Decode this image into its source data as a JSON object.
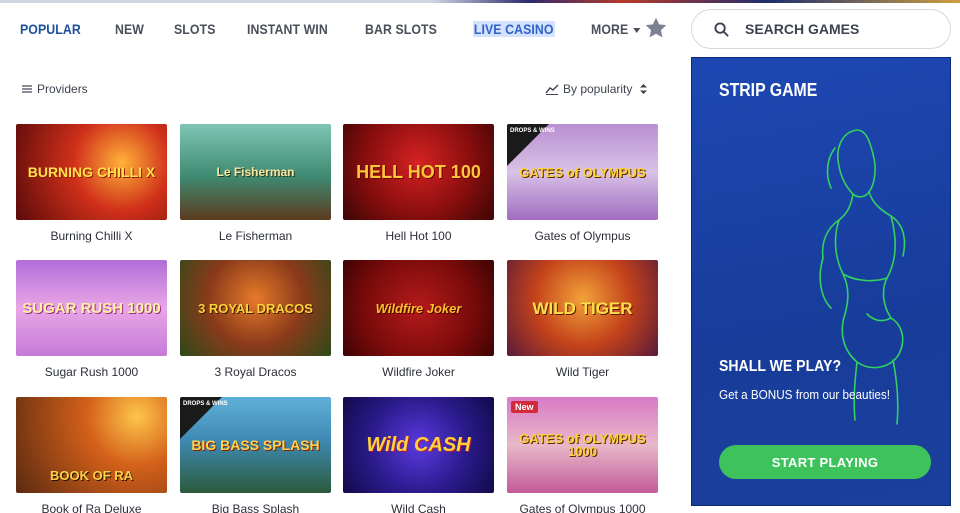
{
  "nav": {
    "items": [
      {
        "label": "POPULAR",
        "state": "active"
      },
      {
        "label": "NEW"
      },
      {
        "label": "SLOTS"
      },
      {
        "label": "INSTANT WIN"
      },
      {
        "label": "BAR SLOTS"
      },
      {
        "label": "LIVE CASINO",
        "state": "highlighted"
      },
      {
        "label": "MORE"
      }
    ],
    "favorites_icon": "star-icon"
  },
  "search": {
    "placeholder": "SEARCH GAMES",
    "icon": "search-icon"
  },
  "filters": {
    "providers_label": "Providers",
    "sort_label": "By popularity"
  },
  "games": [
    {
      "name": "Burning Chilli X",
      "logo": "BURNING CHILLI X"
    },
    {
      "name": "Le Fisherman",
      "logo": "Le Fisherman"
    },
    {
      "name": "Hell Hot 100",
      "logo": "HELL HOT 100"
    },
    {
      "name": "Gates of Olympus",
      "logo": "GATES of OLYMPUS",
      "badge": "DROPS & WINS"
    },
    {
      "name": "Sugar Rush 1000",
      "logo": "SUGAR RUSH 1000"
    },
    {
      "name": "3 Royal Dracos",
      "logo": "3 ROYAL DRACOS"
    },
    {
      "name": "Wildfire Joker",
      "logo": "Wildfire Joker"
    },
    {
      "name": "Wild Tiger",
      "logo": "WILD TIGER"
    },
    {
      "name": "Book of Ra Deluxe",
      "logo": "BOOK OF RA"
    },
    {
      "name": "Big Bass Splash",
      "logo": "BIG BASS SPLASH",
      "badge": "DROPS & WINS"
    },
    {
      "name": "Wild Cash",
      "logo": "Wild CASH"
    },
    {
      "name": "Gates of Olympus 1000",
      "logo": "GATES of OLYMPUS 1000",
      "badge": "New"
    }
  ],
  "promo": {
    "title": "STRIP GAME",
    "question": "SHALL WE PLAY?",
    "text": "Get a BONUS from our beauties!",
    "button": "START PLAYING"
  },
  "colors": {
    "nav_active": "#1c4f9c",
    "nav_highlight_bg": "#d4e2ff",
    "promo_bg": "#1d47b3",
    "promo_line": "#35e05a",
    "cta": "#3ec25b"
  }
}
